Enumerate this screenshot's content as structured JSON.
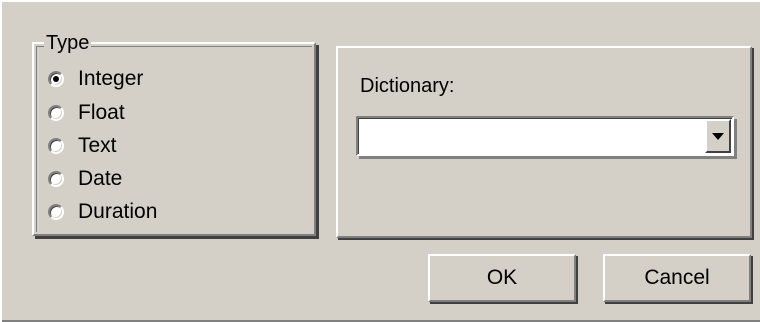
{
  "type_group": {
    "legend": "Type",
    "selected": "Integer",
    "options": [
      {
        "label": "Integer",
        "checked": true
      },
      {
        "label": "Float",
        "checked": false
      },
      {
        "label": "Text",
        "checked": false
      },
      {
        "label": "Date",
        "checked": false
      },
      {
        "label": "Duration",
        "checked": false
      }
    ]
  },
  "dictionary": {
    "label": "Dictionary:",
    "value": ""
  },
  "buttons": {
    "ok_label": "OK",
    "cancel_label": "Cancel"
  },
  "colors": {
    "face": "#d4d0c8",
    "highlight": "#ffffff",
    "shadow": "#808080",
    "dark_shadow": "#404040"
  }
}
